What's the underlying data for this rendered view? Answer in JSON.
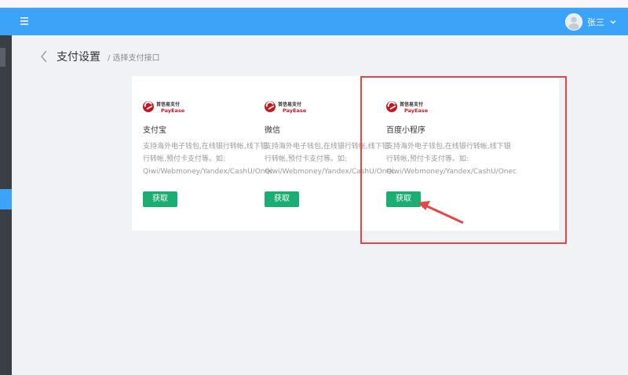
{
  "topbar": {
    "user_name": "张三",
    "accent_color": "#3ba3f8"
  },
  "page": {
    "title": "支付设置",
    "subtitle": "/ 选择支付接口"
  },
  "providers": [
    {
      "logo_brand": "首信易支付",
      "logo_sub": "PayEase",
      "name": "支付宝",
      "desc_line1": "支持海外电子钱包,在线银行转帐,线下银",
      "desc_line2": "行转帐,预付卡支付等。如:",
      "desc_line3": "Qiwi/Webmoney/Yandex/CashU/Onec",
      "button_label": "获取"
    },
    {
      "logo_brand": "首信易支付",
      "logo_sub": "PayEase",
      "name": "微信",
      "desc_line1": "支持海外电子钱包,在线银行转帐,线下银",
      "desc_line2": "行转帐,预付卡支付等。如:",
      "desc_line3": "Qiwi/Webmoney/Yandex/CashU/Onec",
      "button_label": "获取"
    },
    {
      "logo_brand": "首信易支付",
      "logo_sub": "PayEase",
      "name": "百度小程序",
      "desc_line1": "支持海外电子钱包,在线银行转帐,线下银",
      "desc_line2": "行转帐,预付卡支付等。如:",
      "desc_line3": "Qiwi/Webmoney/Yandex/CashU/Onec",
      "button_label": "获取"
    }
  ],
  "colors": {
    "button": "#1aae73",
    "annotation": "#e84545",
    "logo_red": "#c8161d"
  }
}
